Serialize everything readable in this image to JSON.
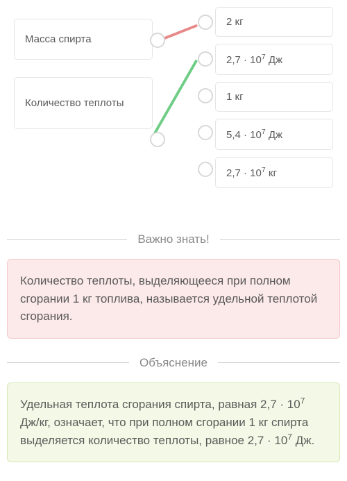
{
  "matching": {
    "leftItems": [
      {
        "label": "Масса спирта"
      },
      {
        "label": "Количество теплоты"
      }
    ],
    "rightItems": [
      {
        "label": "2 кг"
      },
      {
        "label_html": "2,7 · 10<sup>7</sup> Дж"
      },
      {
        "label": "1 кг"
      },
      {
        "label_html": "5,4 · 10<sup>7</sup> Дж"
      },
      {
        "label_html": "2,7 · 10<sup>7</sup> кг"
      }
    ]
  },
  "importantSection": {
    "title": "Важно знать!",
    "text": "Количество теплоты, выделяющееся при полном сгорании 1 кг топлива, называется удельной теплотой сгорания."
  },
  "explanationSection": {
    "title": "Объяснение",
    "text_html": "Удельная теплота сгорания спирта, равная 2,7 · 10<sup>7</sup> Дж/кг, означает, что при полном сгорании 1 кг спирта выделяется количество теплоты, равное 2,7 · 10<sup>7</sup> Дж."
  }
}
